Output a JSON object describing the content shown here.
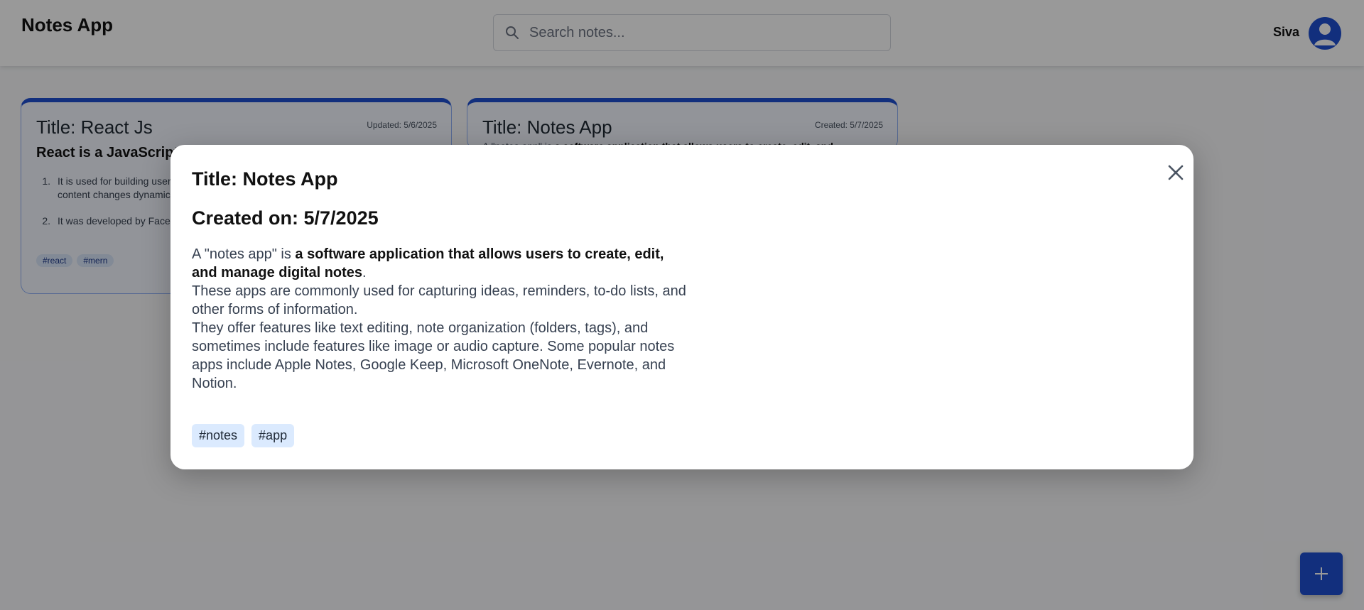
{
  "header": {
    "app_title": "Notes App",
    "search_placeholder": "Search notes...",
    "user_name": "Siva",
    "icons": {
      "search": "search-icon",
      "avatar": "user-avatar-icon"
    }
  },
  "notes": [
    {
      "title": "Title: React Js",
      "date": "Updated: 5/6/2025",
      "heading": "React is a JavaScript lib",
      "list": [
        {
          "num": "1.",
          "text": "It is used for building user interfaces, especially for single-page applications where content changes dynamically without a full page reload."
        },
        {
          "num": "2.",
          "text": "It was developed by Facebook"
        }
      ],
      "tags": [
        "#react",
        "#mern"
      ]
    },
    {
      "title": "Title: Notes App",
      "date": "Created: 5/7/2025",
      "preview_plain": "A \"notes app\" is ",
      "preview_bold": "a software application that allows users to create, edit, and"
    }
  ],
  "modal": {
    "title": "Title: Notes App",
    "created": "Created on: 5/7/2025",
    "intro_plain": "A \"notes app\" is ",
    "intro_bold": "a software application that allows users to create, edit, and manage digital notes",
    "intro_end": ".",
    "para2": "These apps are commonly used for capturing ideas, reminders, to-do lists, and other forms of information.",
    "para3": "They offer features like text editing, note organization (folders, tags), and sometimes include features like image or audio capture. Some popular notes apps include Apple Notes, Google Keep, Microsoft OneNote, Evernote, and Notion.",
    "tags": [
      "#notes",
      "#app"
    ],
    "close_icon": "close-icon"
  },
  "fab": {
    "icon": "plus-icon"
  },
  "colors": {
    "accent": "#1e4fd1",
    "tag_bg": "#dbeafe",
    "overlay": "rgba(0,0,0,0.40)"
  }
}
